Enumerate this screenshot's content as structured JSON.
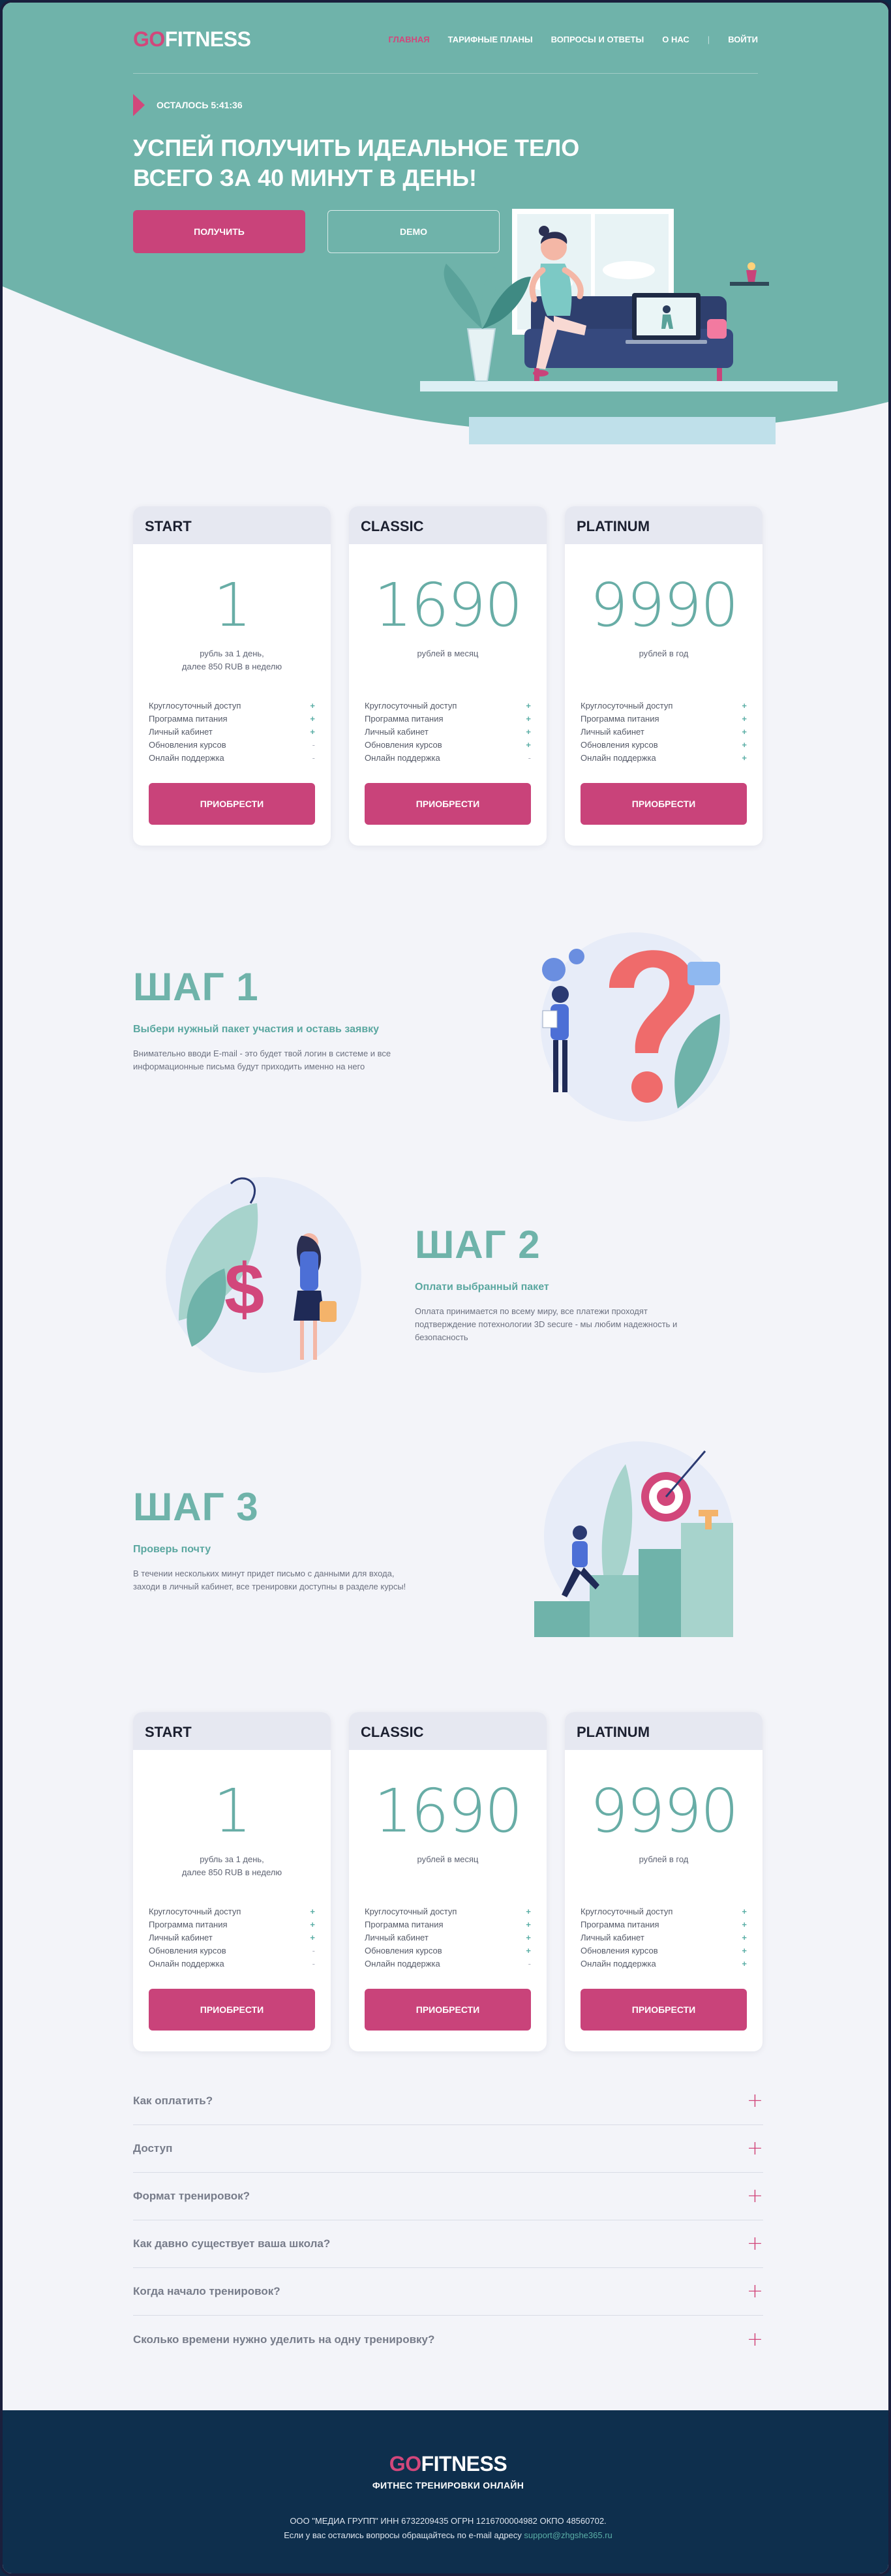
{
  "header": {
    "logo_go": "GO",
    "logo_rest": "FITNESS",
    "menu": [
      {
        "label": "ГЛАВНАЯ",
        "active": true
      },
      {
        "label": "ТАРИФНЫЕ ПЛАНЫ",
        "active": false
      },
      {
        "label": "ВОПРОСЫ И ОТВЕТЫ",
        "active": false
      },
      {
        "label": "О НАС",
        "active": false
      }
    ],
    "separator": "|",
    "login": "ВОЙТИ"
  },
  "hero": {
    "timer": "ОСТАЛОСЬ 5:41:36",
    "title": "УСПЕЙ ПОЛУЧИТЬ ИДЕАЛЬНОЕ ТЕЛО ВСЕГО ЗА 40 МИНУТ В ДЕНЬ!",
    "get_button": "ПОЛУЧИТЬ",
    "demo_button": "DEMO"
  },
  "plans": [
    {
      "name": "START",
      "price": "1",
      "sub": [
        "рубль за 1 день,",
        "далее 850 RUB в неделю"
      ],
      "features": [
        {
          "label": "Круглосуточный доступ",
          "mark": "+"
        },
        {
          "label": "Программа питания",
          "mark": "+"
        },
        {
          "label": "Личный кабинет",
          "mark": "+"
        },
        {
          "label": "Обновления курсов",
          "mark": "-"
        },
        {
          "label": "Онлайн поддержка",
          "mark": "-"
        }
      ],
      "button": "ПРИОБРЕСТИ"
    },
    {
      "name": "CLASSIC",
      "price": "1690",
      "sub": [
        "рублей в месяц",
        ""
      ],
      "features": [
        {
          "label": "Круглосуточный доступ",
          "mark": "+"
        },
        {
          "label": "Программа питания",
          "mark": "+"
        },
        {
          "label": "Личный кабинет",
          "mark": "+"
        },
        {
          "label": "Обновления курсов",
          "mark": "+"
        },
        {
          "label": "Онлайн поддержка",
          "mark": "-"
        }
      ],
      "button": "ПРИОБРЕСТИ"
    },
    {
      "name": "PLATINUM",
      "price": "9990",
      "sub": [
        "рублей в год",
        ""
      ],
      "features": [
        {
          "label": "Круглосуточный доступ",
          "mark": "+"
        },
        {
          "label": "Программа питания",
          "mark": "+"
        },
        {
          "label": "Личный кабинет",
          "mark": "+"
        },
        {
          "label": "Обновления курсов",
          "mark": "+"
        },
        {
          "label": "Онлайн поддержка",
          "mark": "+"
        }
      ],
      "button": "ПРИОБРЕСТИ"
    }
  ],
  "steps": [
    {
      "title": "ШАГ 1",
      "subtitle": "Выбери нужный пакет участия и оставь заявку",
      "text": "Внимательно вводи E-mail - это будет твой логин в системе и все информационные письма будут приходить именно на него"
    },
    {
      "title": "ШАГ 2",
      "subtitle": "Оплати выбранный пакет",
      "text": "Оплата принимается по всему миру, все платежи проходят подтверждение потехнологии 3D secure - мы любим надежность и безопасность"
    },
    {
      "title": "ШАГ 3",
      "subtitle": "Проверь почту",
      "text": "В течении нескольких минут придет письмо с данными для входа, заходи в личный кабинет, все тренировки доступны в разделе курсы!"
    }
  ],
  "faq": [
    {
      "q": "Как оплатить?",
      "icon": "plus-icon"
    },
    {
      "q": "Доступ",
      "icon": "plus-icon"
    },
    {
      "q": "Формат тренировок?",
      "icon": "plus-icon"
    },
    {
      "q": "Как давно существует ваша школа?",
      "icon": "plus-icon"
    },
    {
      "q": "Когда начало тренировок?",
      "icon": "plus-icon"
    },
    {
      "q": "Сколько времени нужно уделить на одну тренировку?",
      "icon": "plus-icon"
    }
  ],
  "faq_plus": "+",
  "footer": {
    "logo_go": "GO",
    "logo_rest": "FITNESS",
    "tagline": "ФИТНЕС ТРЕНИРОВКИ ОНЛАЙН",
    "legal": "ООО \"МЕДИА ГРУПП\" ИНН 6732209435 ОГРН 1216700004982 ОКПО 48560702.",
    "contact": "Если у вас остались вопросы обращайтесь по e-mail адресу",
    "email": "support@zhgshe365.ru"
  },
  "colors": {
    "teal": "#6fb3aa",
    "pink": "#c9437a",
    "navy": "#0e2f4d",
    "bg": "#f3f4f9"
  }
}
